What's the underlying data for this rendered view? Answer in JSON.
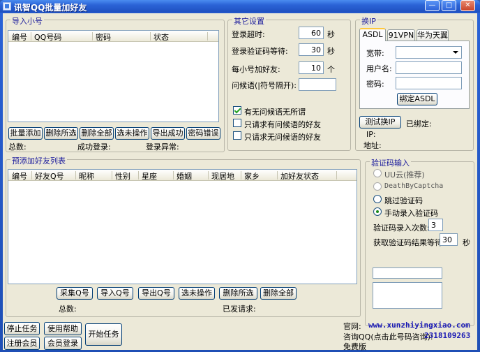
{
  "window": {
    "title": "讯智QQ批量加好友",
    "min": "—",
    "max": "□",
    "close": "✕"
  },
  "import_group": {
    "title": "导入小号",
    "columns": [
      "编号",
      "QQ号码",
      "密码",
      "状态"
    ],
    "buttons": [
      "批量添加",
      "删除所选",
      "删除全部",
      "选未操作",
      "导出成功",
      "密码错误"
    ],
    "total": "总数:",
    "success": "成功登录:",
    "error": "登录异常:"
  },
  "settings": {
    "title": "其它设置",
    "login_timeout_label": "登录超时:",
    "login_timeout": "60",
    "login_timeout_unit": "秒",
    "captcha_wait_label": "登录验证码等待:",
    "captcha_wait": "30",
    "captcha_wait_unit": "秒",
    "per_account_label": "每小号加好友:",
    "per_account": "10",
    "per_account_unit": "个",
    "greeting_label": "问候语(|符号隔开):",
    "greeting": "",
    "checks": [
      {
        "label": "有无问候语无所谓",
        "checked": true
      },
      {
        "label": "只请求有问候语的好友",
        "checked": false
      },
      {
        "label": "只请求无问候语的好友",
        "checked": false
      }
    ]
  },
  "ip": {
    "title": "换IP",
    "tabs": [
      "ASDL",
      "91VPN",
      "华为天翼"
    ],
    "broadband_label": "宽带:",
    "username_label": "用户名:",
    "password_label": "密码:",
    "bind_button": "绑定ASDL",
    "test_button": "测试换IP",
    "bound_label": "已绑定:",
    "ip_label": "IP:",
    "addr_label": "地址:"
  },
  "friends_group": {
    "title": "预添加好友列表",
    "columns": [
      "编号",
      "好友Q号",
      "昵称",
      "性别",
      "星座",
      "婚姻",
      "现居地",
      "家乡",
      "加好友状态"
    ],
    "buttons": [
      "采集Q号",
      "导入Q号",
      "导出Q号",
      "选未操作",
      "删除所选",
      "删除全部"
    ],
    "total": "总数:",
    "sent": "已发请求:"
  },
  "captcha": {
    "title": "验证码输入",
    "options": [
      {
        "label": "UU云(推荐)",
        "checked": false,
        "dim": true
      },
      {
        "label": "DeathByCaptcha",
        "checked": false,
        "dim": true
      },
      {
        "label": "跳过验证码",
        "checked": false,
        "dim": false
      },
      {
        "label": "手动录入验证码",
        "checked": true,
        "dim": false
      }
    ],
    "retry_label": "验证码录入次数:",
    "retry": "3",
    "result_wait_label": "获取验证码结果等待:",
    "result_wait": "30",
    "result_wait_unit": "秒"
  },
  "bottom": {
    "stop": "停止任务",
    "help": "使用帮助",
    "register": "注册会员",
    "login": "会员登录",
    "start": "开始任务",
    "website_label": "官网:",
    "website": "www.xunzhiyingxiao.com",
    "consult_label": "咨询QQ(点击此号码咨询):",
    "consult_qq": "2318109263",
    "edition": "免费版"
  }
}
